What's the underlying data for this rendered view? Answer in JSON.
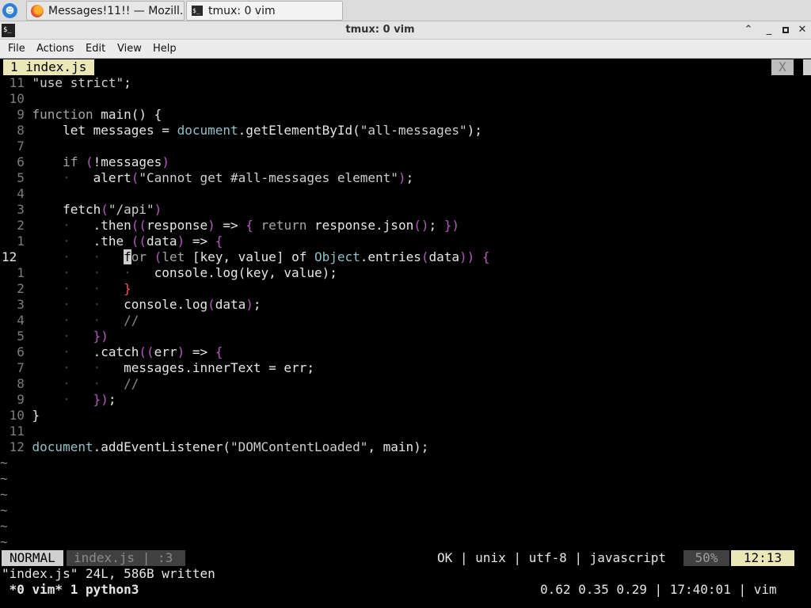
{
  "taskbar": {
    "launcher_glyph": "☻",
    "tasks": [
      {
        "label": "Messages!11!! — Mozill...",
        "icon": "firefox-icon"
      },
      {
        "label": "tmux: 0 vim",
        "icon": "terminal-icon"
      }
    ]
  },
  "window": {
    "title": "tmux: 0 vim",
    "icon_glyph": "$_",
    "buttons": {
      "shade": "⌃",
      "minimize": "_",
      "close": "✕"
    }
  },
  "menubar": [
    "File",
    "Actions",
    "Edit",
    "View",
    "Help"
  ],
  "vim": {
    "tab_label": "1 index.js",
    "tab_close": "X",
    "code": [
      {
        "n": "11",
        "t": [
          [
            "str",
            "\"use strict\""
          ],
          [
            "",
            "; "
          ]
        ]
      },
      {
        "n": "10",
        "t": []
      },
      {
        "n": " 9",
        "t": [
          [
            "kw",
            "function"
          ],
          [
            "",
            " main() {"
          ]
        ]
      },
      {
        "n": " 8",
        "t": [
          [
            "",
            "    let messages = "
          ],
          [
            "obj",
            "document"
          ],
          [
            "",
            ".getElementById("
          ],
          [
            "str",
            "\"all-messages\""
          ],
          [
            "",
            ");"
          ]
        ]
      },
      {
        "n": " 7",
        "t": []
      },
      {
        "n": " 6",
        "t": [
          [
            "",
            "    "
          ],
          [
            "kw",
            "if"
          ],
          [
            "",
            " "
          ],
          [
            "pun",
            "("
          ],
          [
            "",
            "!messages"
          ],
          [
            "pun",
            ")"
          ]
        ]
      },
      {
        "n": " 5",
        "t": [
          [
            "guide",
            "    ·   "
          ],
          [
            "",
            "alert"
          ],
          [
            "pun",
            "("
          ],
          [
            "str",
            "\"Cannot get #all-messages element\""
          ],
          [
            "pun",
            ")"
          ],
          [
            "",
            ";"
          ]
        ]
      },
      {
        "n": " 4",
        "t": []
      },
      {
        "n": " 3",
        "t": [
          [
            "",
            "    fetch"
          ],
          [
            "pun",
            "("
          ],
          [
            "str",
            "\"/api\""
          ],
          [
            "pun",
            ")"
          ]
        ]
      },
      {
        "n": " 2",
        "t": [
          [
            "guide",
            "    ·   "
          ],
          [
            "",
            ".then"
          ],
          [
            "pun",
            "(("
          ],
          [
            "",
            "response"
          ],
          [
            "pun",
            ")"
          ],
          [
            "",
            " => "
          ],
          [
            "pun",
            "{"
          ],
          [
            "",
            " "
          ],
          [
            "kw",
            "return"
          ],
          [
            "",
            " response.json"
          ],
          [
            "pun",
            "()"
          ],
          [
            "",
            "; "
          ],
          [
            "pun",
            "})"
          ]
        ]
      },
      {
        "n": " 1",
        "t": [
          [
            "guide",
            "    ·   "
          ],
          [
            "",
            ".the "
          ],
          [
            "pun",
            "(("
          ],
          [
            "",
            "data"
          ],
          [
            "pun",
            ")"
          ],
          [
            "",
            " => "
          ],
          [
            "pun",
            "{"
          ]
        ]
      },
      {
        "n": "12",
        "cur": true,
        "t": [
          [
            "guide",
            "    ·   ·   "
          ],
          [
            "cursor",
            "f"
          ],
          [
            "kw",
            "or"
          ],
          [
            "",
            " "
          ],
          [
            "pun",
            "("
          ],
          [
            "kw",
            "let"
          ],
          [
            "",
            " [key, value] of "
          ],
          [
            "obj",
            "Object"
          ],
          [
            "",
            ".entries"
          ],
          [
            "pun",
            "("
          ],
          [
            "",
            "data"
          ],
          [
            "pun",
            "))"
          ],
          [
            "",
            " "
          ],
          [
            "pun",
            "{"
          ]
        ]
      },
      {
        "n": " 1",
        "t": [
          [
            "guide",
            "    ·   ·   ·   "
          ],
          [
            "",
            "console.log(key, value);"
          ]
        ]
      },
      {
        "n": " 2",
        "t": [
          [
            "guide",
            "    ·   ·   "
          ],
          [
            "red",
            "}"
          ]
        ]
      },
      {
        "n": " 3",
        "t": [
          [
            "guide",
            "    ·   ·   "
          ],
          [
            "",
            "console.log"
          ],
          [
            "pun",
            "("
          ],
          [
            "",
            "data"
          ],
          [
            "pun",
            ")"
          ],
          [
            "",
            ";"
          ]
        ]
      },
      {
        "n": " 4",
        "t": [
          [
            "guide",
            "    ·   ·   "
          ],
          [
            "cmt",
            "//"
          ]
        ]
      },
      {
        "n": " 5",
        "t": [
          [
            "guide",
            "    ·   "
          ],
          [
            "pun",
            "})"
          ]
        ]
      },
      {
        "n": " 6",
        "t": [
          [
            "guide",
            "    ·   "
          ],
          [
            "",
            ".catch"
          ],
          [
            "pun",
            "(("
          ],
          [
            "",
            "err"
          ],
          [
            "pun",
            ")"
          ],
          [
            "",
            " => "
          ],
          [
            "pun",
            "{"
          ]
        ]
      },
      {
        "n": " 7",
        "t": [
          [
            "guide",
            "    ·   ·   "
          ],
          [
            "",
            "messages.innerText = err;"
          ]
        ]
      },
      {
        "n": " 8",
        "t": [
          [
            "guide",
            "    ·   ·   "
          ],
          [
            "cmt",
            "//"
          ]
        ]
      },
      {
        "n": " 9",
        "t": [
          [
            "guide",
            "    ·   "
          ],
          [
            "pun",
            "})"
          ],
          [
            "",
            ";"
          ]
        ]
      },
      {
        "n": "10",
        "t": [
          [
            "",
            "}"
          ]
        ]
      },
      {
        "n": "11",
        "t": []
      },
      {
        "n": "12",
        "t": [
          [
            "obj",
            "document"
          ],
          [
            "",
            ".addEventListener("
          ],
          [
            "str",
            "\"DOMContentLoaded\""
          ],
          [
            "",
            ", main);"
          ]
        ]
      }
    ],
    "tildes": [
      "~",
      "~",
      "~",
      "~",
      "~",
      "~"
    ],
    "status": {
      "mode": "NORMAL",
      "file": "index.js | :3",
      "right": "OK | unix | utf-8 | javascript",
      "percent": "50%",
      "position": "12:13"
    },
    "message": "\"index.js\" 24L, 586B written"
  },
  "tmux": {
    "left": " *0 vim* 1 python3",
    "right": "0.62 0.35 0.29 | 17:40:01 | vim"
  }
}
